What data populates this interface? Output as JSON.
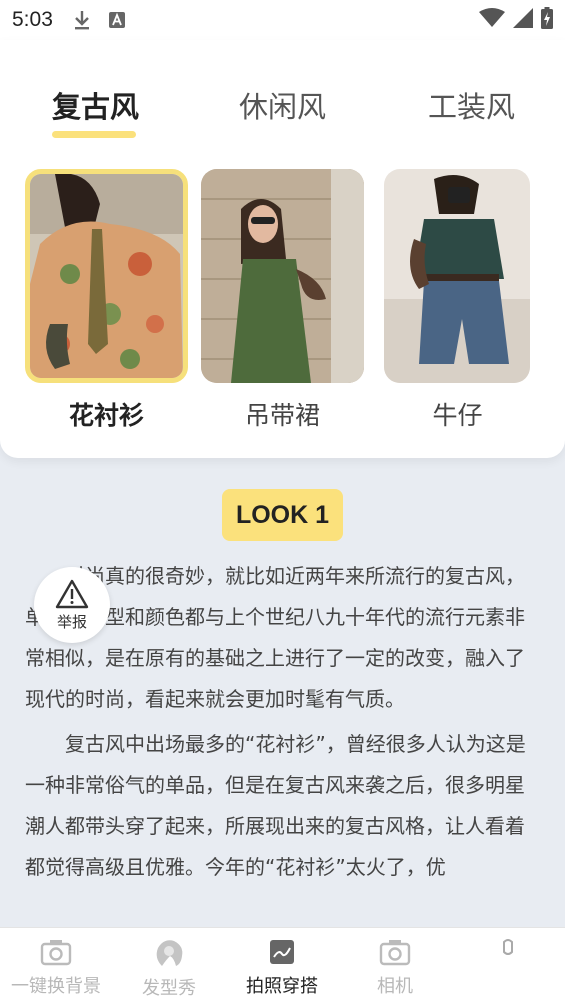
{
  "status": {
    "time": "5:03"
  },
  "tabs": [
    {
      "label": "复古风",
      "active": true
    },
    {
      "label": "休闲风",
      "active": false
    },
    {
      "label": "工装风",
      "active": false
    }
  ],
  "styles": [
    {
      "label": "花衬衫",
      "selected": true
    },
    {
      "label": "吊带裙",
      "selected": false
    },
    {
      "label": "牛仔",
      "selected": false
    }
  ],
  "look": {
    "badge": "LOOK 1"
  },
  "article": {
    "paragraphs": [
      "时尚真的很奇妙，就比如近两年来所流行的复古风，单品的版型和颜色都与上个世纪八九十年代的流行元素非常相似，是在原有的基础之上进行了一定的改变，融入了现代的时尚，看起来就会更加时髦有气质。",
      "复古风中出场最多的“花衬衫”，曾经很多人认为这是一种非常俗气的单品，但是在复古风来袭之后，很多明星潮人都带头穿了起来，所展现出来的复古风格，让人看着都觉得高级且优雅。今年的“花衬衫”太火了，优"
    ]
  },
  "report": {
    "label": "举报"
  },
  "nav": [
    {
      "label": "一键换背景",
      "icon": "camera-icon",
      "active": false
    },
    {
      "label": "发型秀",
      "icon": "hair-icon",
      "active": false
    },
    {
      "label": "拍照穿搭",
      "icon": "photo-outfit-icon",
      "active": true
    },
    {
      "label": "相机",
      "icon": "camera-icon",
      "active": false
    },
    {
      "label": "",
      "icon": "profile-icon",
      "active": false
    }
  ],
  "colors": {
    "accent": "#fbe17c",
    "background": "#e8ecf2"
  }
}
